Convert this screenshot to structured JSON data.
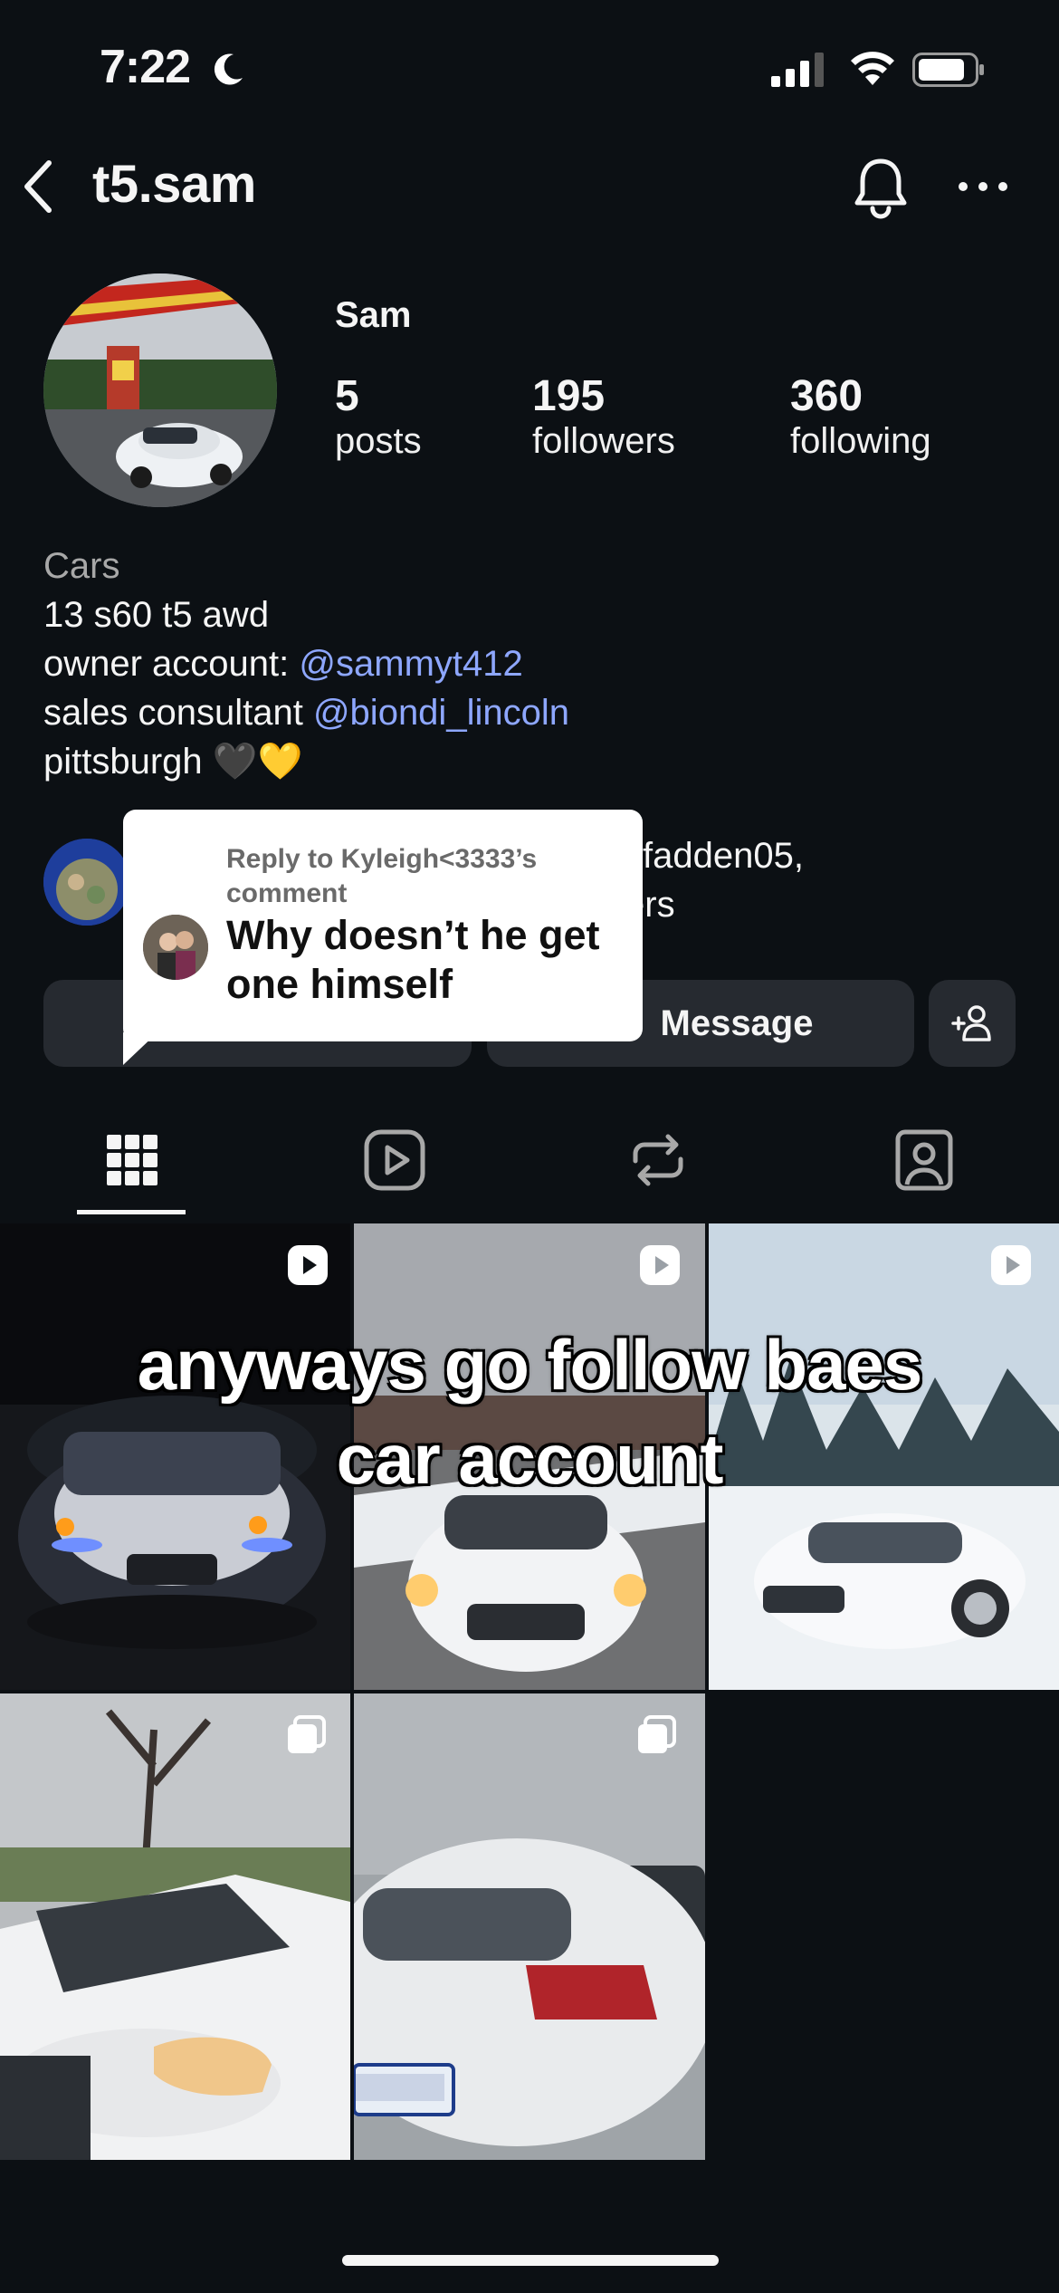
{
  "status": {
    "time": "7:22"
  },
  "header": {
    "username": "t5.sam"
  },
  "profile": {
    "name": "Sam",
    "stats": [
      {
        "value": "5",
        "label": "posts"
      },
      {
        "value": "195",
        "label": "followers"
      },
      {
        "value": "360",
        "label": "following"
      }
    ],
    "bio": {
      "category": "Cars",
      "line1": "13 s60 t5 awd",
      "line2_prefix": "owner account: ",
      "line2_link": "@sammyt412",
      "line3_prefix": "sales consultant ",
      "line3_link": "@biondi_lincoln",
      "line4": "pittsburgh 🖤💛"
    },
    "mutual": {
      "line1": "cfadden05,",
      "line2": "ers"
    }
  },
  "actions": {
    "message_label": "Message"
  },
  "sticker": {
    "reply_to": "Reply to Kyleigh<3333’s comment",
    "comment": "Why doesn’t he get one himself"
  },
  "overlay": {
    "caption_line1": "anyways go follow baes",
    "caption_line2": "car account"
  },
  "tabs": [
    "grid-icon",
    "reels-icon",
    "reposts-icon",
    "tagged-icon"
  ],
  "posts": [
    {
      "type": "reel"
    },
    {
      "type": "reel"
    },
    {
      "type": "reel"
    },
    {
      "type": "carousel"
    },
    {
      "type": "carousel"
    }
  ],
  "colors": {
    "background": "#0c1014",
    "link": "#8ea7ff",
    "button": "#262a30"
  }
}
